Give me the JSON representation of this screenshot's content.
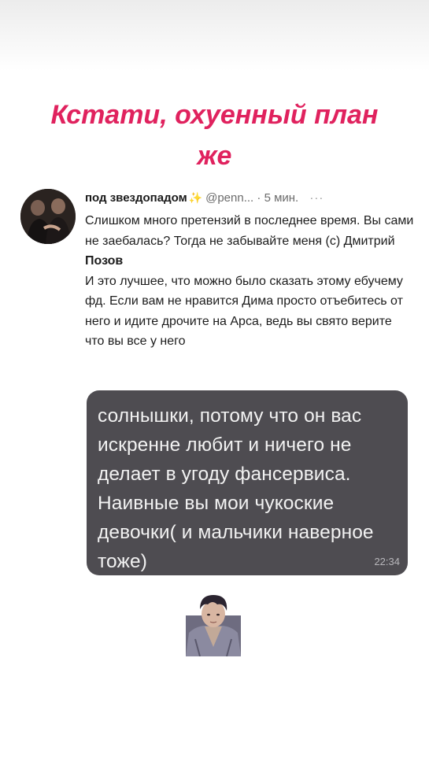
{
  "headline": {
    "line1": "Кстати, охуенный план",
    "line2": "же"
  },
  "tweet": {
    "author": "под звездопадом",
    "sparkle": "✨",
    "handle": "@penn...",
    "separator": "·",
    "time": "5 мин.",
    "more": "···",
    "text_part1": "Слишком много претензий в последнее время. Вы сами не заебалась? Тогда не забывайте меня (с) Дмитрий ",
    "text_bold": "Позов",
    "text_part2": "И это лучшее, что можно было сказать этому ебучему фд. Если вам не нравится Дима просто отъебитесь от него и идите дрочите на Арса, ведь вы свято верите что вы все у него"
  },
  "message": {
    "text": "солнышки, потому что он вас искренне любит и ничего не делает в угоду фансервиса. Наивные вы мои чукоские девочки( и мальчики наверное тоже)",
    "time": "22:34"
  },
  "colors": {
    "headline": "#e0225e",
    "bubble": "#4e4c51",
    "bubble_text": "#f2f2f2"
  }
}
